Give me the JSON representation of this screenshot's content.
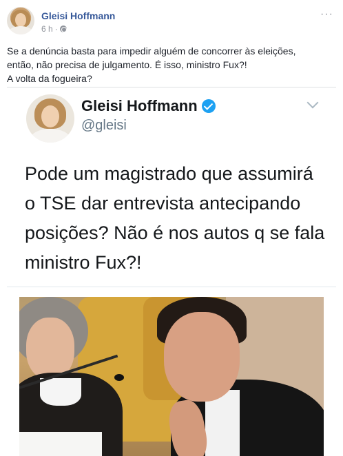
{
  "post": {
    "author": "Gleisi Hoffmann",
    "time": "6 h",
    "separator": "·",
    "more_label": "···",
    "text_lines": [
      "Se a denúncia basta para impedir alguém de concorrer às eleições,",
      "então, não precisa de julgamento. É isso, ministro Fux?!",
      "A volta da fogueira?"
    ]
  },
  "tweet": {
    "name": "Gleisi Hoffmann",
    "handle": "@gleisi",
    "text": "Pode um magistrado que assumirá o TSE dar entrevista antecipando posições? Não é nos autos q se fala ministro Fux?!"
  },
  "icons": {
    "globe": "globe-icon",
    "verified": "verified-icon",
    "chevron": "chevron-down-icon",
    "more": "more-icon"
  },
  "colors": {
    "fb_link": "#365899",
    "meta_gray": "#90949c",
    "twitter_blue": "#1da1f2",
    "twitter_gray": "#657786"
  }
}
